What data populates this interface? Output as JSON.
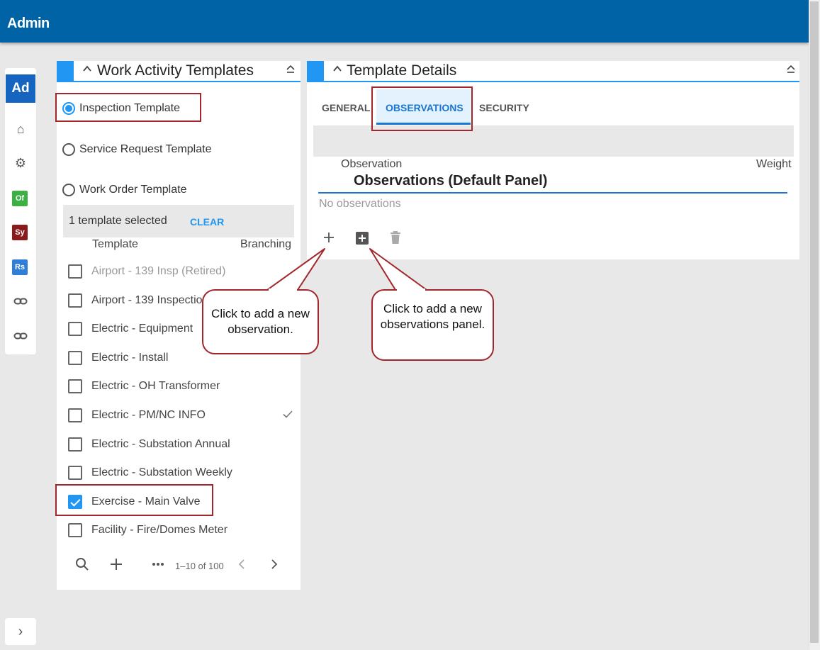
{
  "app": {
    "title": "Admin"
  },
  "sidenav": {
    "logo": "Ad",
    "items": [
      {
        "icon": "home-icon",
        "glyph": "⌂"
      },
      {
        "icon": "gear-icon",
        "glyph": "⚙"
      },
      {
        "icon": "of-badge",
        "label": "Of",
        "color": "#3cb043"
      },
      {
        "icon": "sy-badge",
        "label": "Sy",
        "color": "#8b1a1a"
      },
      {
        "icon": "rs-badge",
        "label": "Rs",
        "color": "#2f7fd8"
      },
      {
        "icon": "link-icon",
        "glyph": "⚭"
      },
      {
        "icon": "link-icon",
        "glyph": "⚭"
      }
    ],
    "expand_glyph": "›"
  },
  "templates_panel": {
    "title": "Work Activity Templates",
    "types": [
      {
        "label": "Inspection Template",
        "selected": true
      },
      {
        "label": "Service Request Template",
        "selected": false
      },
      {
        "label": "Work Order Template",
        "selected": false
      }
    ],
    "selection": {
      "text": "1 template selected",
      "clear": "CLEAR"
    },
    "columns": {
      "template": "Template",
      "branching": "Branching"
    },
    "rows": [
      {
        "label": "Airport - 139 Insp (Retired)",
        "checked": false,
        "retired": true,
        "branching": false
      },
      {
        "label": "Airport - 139 Inspection",
        "checked": false,
        "retired": false,
        "branching": false
      },
      {
        "label": "Electric - Equipment",
        "checked": false,
        "retired": false,
        "branching": false
      },
      {
        "label": "Electric - Install",
        "checked": false,
        "retired": false,
        "branching": false
      },
      {
        "label": "Electric - OH Transformer",
        "checked": false,
        "retired": false,
        "branching": false
      },
      {
        "label": "Electric - PM/NC INFO",
        "checked": false,
        "retired": false,
        "branching": true
      },
      {
        "label": "Electric - Substation Annual",
        "checked": false,
        "retired": false,
        "branching": false
      },
      {
        "label": "Electric - Substation Weekly",
        "checked": false,
        "retired": false,
        "branching": false
      },
      {
        "label": "Exercise - Main Valve",
        "checked": true,
        "retired": false,
        "branching": false
      },
      {
        "label": "Facility - Fire/Domes Meter",
        "checked": false,
        "retired": false,
        "branching": false
      }
    ],
    "pager": {
      "range": "1–10 of 100"
    }
  },
  "details_panel": {
    "title": "Template Details",
    "tabs": [
      {
        "label": "GENERAL",
        "active": false
      },
      {
        "label": "OBSERVATIONS",
        "active": true
      },
      {
        "label": "SECURITY",
        "active": false
      }
    ],
    "columns": {
      "observation": "Observation",
      "weight": "Weight"
    },
    "panel_name": "Observations (Default Panel)",
    "empty_text": "No observations"
  },
  "callouts": {
    "add_observation": "Click to add a new observation.",
    "add_panel": "Click to add a new observations panel."
  }
}
